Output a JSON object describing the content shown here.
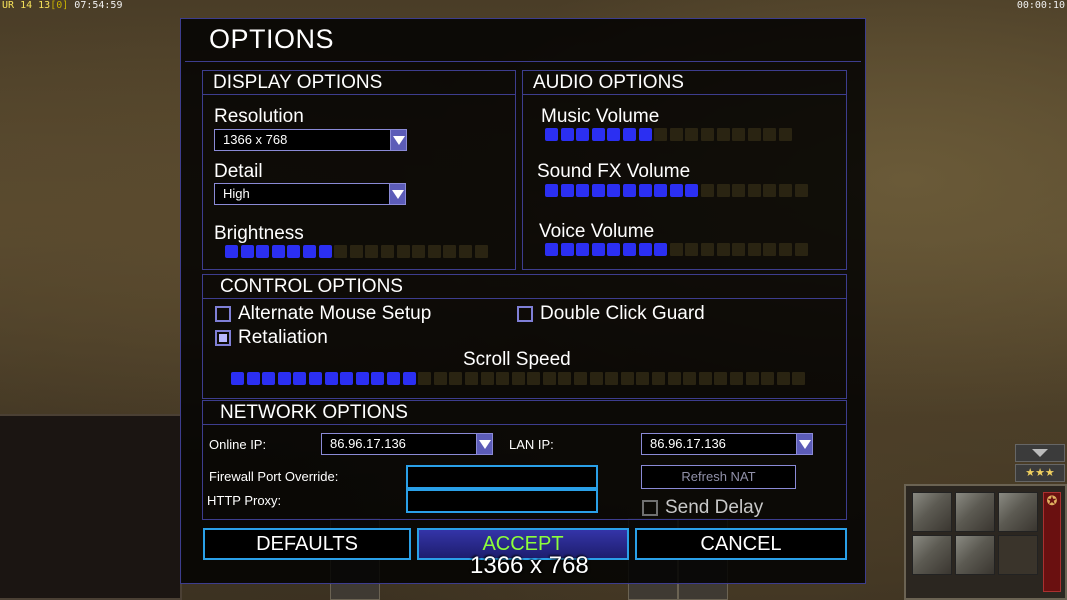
{
  "hud": {
    "status_left": {
      "ur": "UR",
      "a": "14",
      "b": "13",
      "c": "[0]",
      "time": "07:54:59"
    },
    "status_right": "00:00:10",
    "stars": "★★★",
    "unit_star": "✪"
  },
  "dialog": {
    "title": "OPTIONS",
    "display": {
      "header": "DISPLAY OPTIONS",
      "resolution_label": "Resolution",
      "resolution_value": "1366 x 768",
      "detail_label": "Detail",
      "detail_value": "High",
      "brightness_label": "Brightness",
      "brightness_level": 7,
      "brightness_segments": 17
    },
    "audio": {
      "header": "AUDIO OPTIONS",
      "music_label": "Music Volume",
      "music_level": 7,
      "music_segments": 16,
      "sfx_label": "Sound FX Volume",
      "sfx_level": 10,
      "sfx_segments": 17,
      "voice_label": "Voice Volume",
      "voice_level": 8,
      "voice_segments": 17
    },
    "control": {
      "header": "CONTROL OPTIONS",
      "alt_mouse_label": "Alternate Mouse Setup",
      "alt_mouse_checked": false,
      "double_click_label": "Double Click Guard",
      "double_click_checked": false,
      "retaliation_label": "Retaliation",
      "retaliation_checked": true,
      "scroll_label": "Scroll Speed",
      "scroll_level": 12,
      "scroll_segments": 37
    },
    "network": {
      "header": "NETWORK OPTIONS",
      "online_ip_label": "Online IP:",
      "online_ip_value": "86.96.17.136",
      "lan_ip_label": "LAN IP:",
      "lan_ip_value": "86.96.17.136",
      "firewall_label": "Firewall Port Override:",
      "firewall_value": "",
      "proxy_label": "HTTP Proxy:",
      "proxy_value": "",
      "refresh_label": "Refresh NAT",
      "send_delay_label": "Send Delay",
      "send_delay_checked": false
    },
    "buttons": {
      "defaults": "DEFAULTS",
      "accept": "ACCEPT",
      "cancel": "CANCEL"
    },
    "tooltip": "1366 x 768"
  }
}
